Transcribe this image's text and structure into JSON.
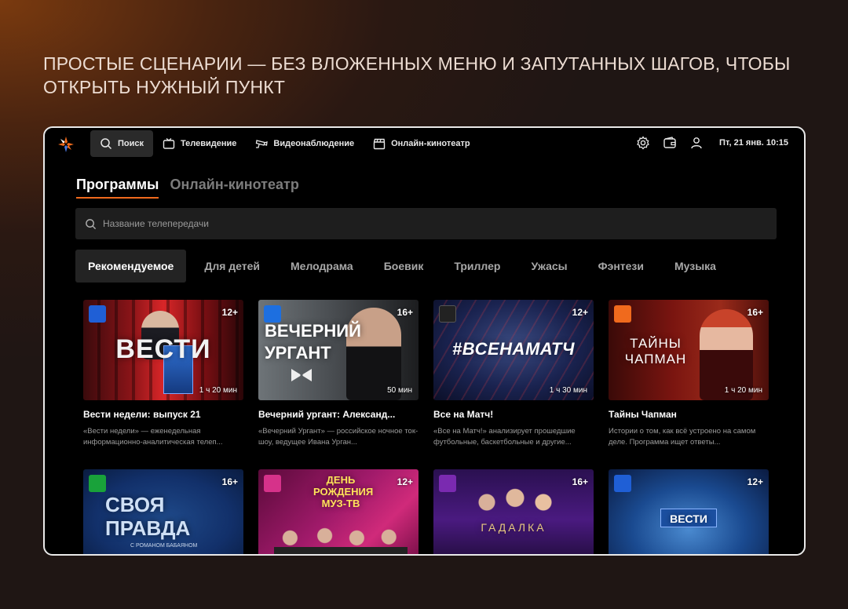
{
  "headline": {
    "line1": "ПРОСТЫЕ СЦЕНАРИИ — БЕЗ ВЛОЖЕННЫХ МЕНЮ И ЗАПУТАННЫХ ШАГОВ, ЧТОБЫ",
    "line2": "ОТКРЫТЬ НУЖНЫЙ ПУНКТ"
  },
  "colors": {
    "accent": "#f06a1d",
    "frame_border": "#e9e9e9"
  },
  "nav": {
    "items": [
      {
        "label": "Поиск",
        "icon": "search-icon",
        "active": true
      },
      {
        "label": "Телевидение",
        "icon": "tv-icon"
      },
      {
        "label": "Видеонаблюдение",
        "icon": "camera-icon"
      },
      {
        "label": "Онлайн-кинотеатр",
        "icon": "clapperboard-icon"
      }
    ],
    "datetime": "Пт, 21 янв. 10:15"
  },
  "section_tabs": [
    "Программы",
    "Онлайн-кинотеатр"
  ],
  "search": {
    "placeholder": "Название телепередачи"
  },
  "genres": [
    "Рекомендуемое",
    "Для детей",
    "Мелодрама",
    "Боевик",
    "Триллер",
    "Ужасы",
    "Фэнтези",
    "Музыка"
  ],
  "cards": [
    {
      "art_title": "ВЕСТИ",
      "age": "12+",
      "duration": "1 ч 20 мин",
      "title": "Вести недели: выпуск 21",
      "description": "«Вести недели» — еженедельная информационно-аналитическая телеп..."
    },
    {
      "art_title": "ВЕЧЕРНИЙ УРГАНТ",
      "age": "16+",
      "duration": "50 мин",
      "title": "Вечерний ургант: Александ...",
      "description": "«Вечерний Ургант» — российское ночное ток-шоу, ведущее Ивана Урган..."
    },
    {
      "art_title": "#ВСЕНАМАТЧ",
      "age": "12+",
      "duration": "1 ч 30 мин",
      "title": "Все на Матч!",
      "description": "«Все на Матч!» анализирует прошедшие футбольные, баскетбольные и другие..."
    },
    {
      "art_title": "ТАЙНЫ ЧАПМАН",
      "age": "16+",
      "duration": "1 ч 20 мин",
      "title": "Тайны Чапман",
      "description": "Истории о том, как всё устроено на самом деле. Программа ищет ответы..."
    },
    {
      "art_title": "СВОЯ ПРАВДА",
      "art_subtitle": "С РОМАНОМ БАБАЯНОМ",
      "age": "16+"
    },
    {
      "art_title": "ДЕНЬ РОЖДЕНИЯ МУЗ-ТВ",
      "age": "12+"
    },
    {
      "art_title": "ГАДАЛКА",
      "age": "16+"
    },
    {
      "art_title": "ВЕСТИ",
      "age": "12+"
    }
  ]
}
